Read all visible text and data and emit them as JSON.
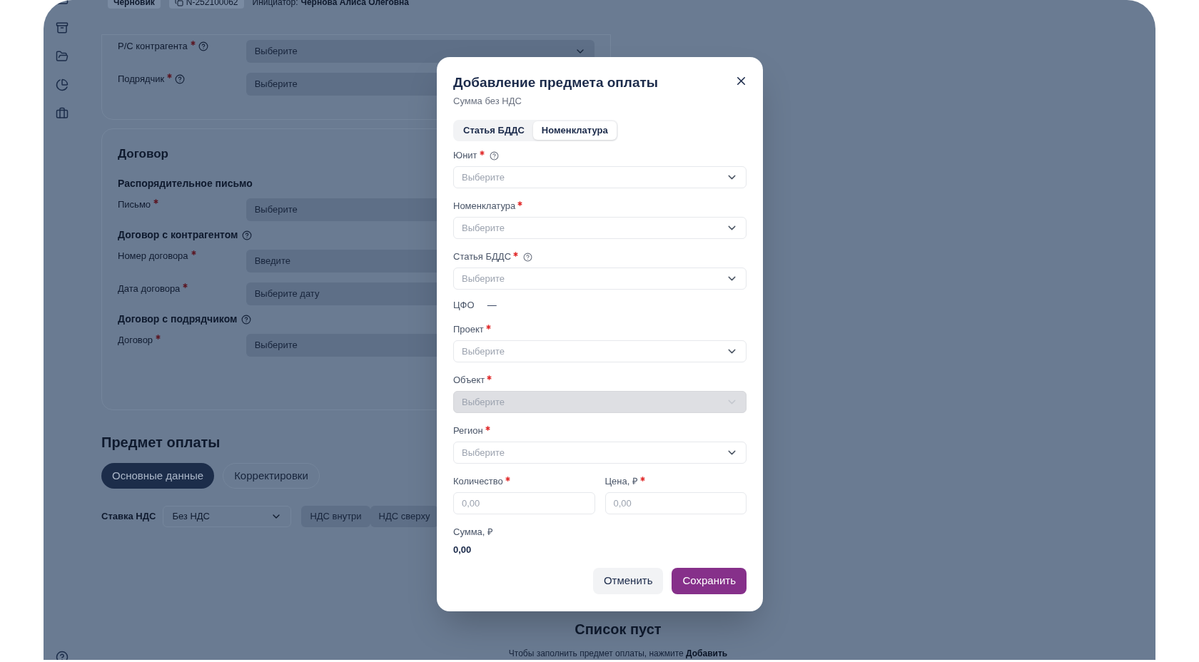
{
  "header": {
    "status": "Черновик",
    "number": "N-252100062",
    "initiator_label": "Инициатор:",
    "initiator": "Чернова Алиса Олеговна"
  },
  "top_fields": [
    {
      "label": "Р/С контрагента",
      "required": true,
      "help": true,
      "placeholder": "Выберите",
      "kind": "select"
    },
    {
      "label": "Подрядчик",
      "required": true,
      "help": true,
      "placeholder": "Выберите",
      "kind": "input"
    }
  ],
  "contract": {
    "title": "Договор",
    "sections": [
      {
        "title": "Распорядительное письмо",
        "help": false,
        "fields": [
          {
            "label": "Письмо",
            "required": true,
            "placeholder": "Выберите"
          }
        ]
      },
      {
        "title": "Договор с контрагентом",
        "help": true,
        "fields": [
          {
            "label": "Номер договора",
            "required": true,
            "placeholder": "Введите"
          },
          {
            "label": "Дата договора",
            "required": true,
            "placeholder": "Выберите дату"
          }
        ]
      },
      {
        "title": "Договор с подрядчиком",
        "help": true,
        "fields": [
          {
            "label": "Договор",
            "required": true,
            "placeholder": "Выберите"
          }
        ]
      }
    ]
  },
  "payment": {
    "title": "Предмет оплаты",
    "tabs": [
      {
        "label": "Основные данные",
        "selected": true
      },
      {
        "label": "Корректировки",
        "selected": false
      }
    ],
    "vat": {
      "label": "Ставка НДС",
      "value": "Без НДС",
      "options": [
        {
          "label": "НДС внутри"
        },
        {
          "label": "НДС сверху"
        }
      ]
    },
    "empty": {
      "title": "Список пуст",
      "text": "Чтобы заполнить предмет оплаты, нажмите **Добавить**"
    }
  },
  "modal": {
    "title": "Добавление предмета оплаты",
    "subtitle": "Сумма без НДС",
    "tabs": [
      {
        "label": "Статья БДДС",
        "selected": false
      },
      {
        "label": "Номенклатура",
        "selected": true
      }
    ],
    "fields": [
      {
        "kind": "select",
        "label": "Юнит",
        "required": true,
        "help": true,
        "placeholder": "Выберите",
        "disabled": false
      },
      {
        "kind": "select",
        "label": "Номенклатура",
        "required": true,
        "help": false,
        "placeholder": "Выберите",
        "disabled": false
      },
      {
        "kind": "select",
        "label": "Статья БДДС",
        "required": true,
        "help": true,
        "placeholder": "Выберите",
        "disabled": false
      },
      {
        "kind": "value",
        "label": "ЦФО",
        "value": "—"
      },
      {
        "kind": "select",
        "label": "Проект",
        "required": true,
        "help": false,
        "placeholder": "Выберите",
        "disabled": false
      },
      {
        "kind": "select",
        "label": "Объект",
        "required": true,
        "help": false,
        "placeholder": "Выберите",
        "disabled": true
      },
      {
        "kind": "select",
        "label": "Регион",
        "required": true,
        "help": false,
        "placeholder": "Выберите",
        "disabled": false
      },
      {
        "kind": "inputs",
        "items": [
          {
            "label": "Количество",
            "required": true,
            "placeholder": "0,00"
          },
          {
            "label": "Цена, ₽",
            "required": true,
            "placeholder": "0,00"
          }
        ]
      },
      {
        "kind": "total",
        "label": "Сумма, ₽",
        "value": "0,00"
      }
    ],
    "buttons": [
      {
        "label": "Отменить",
        "kind": "secondary"
      },
      {
        "label": "Сохранить",
        "kind": "primary"
      }
    ]
  }
}
